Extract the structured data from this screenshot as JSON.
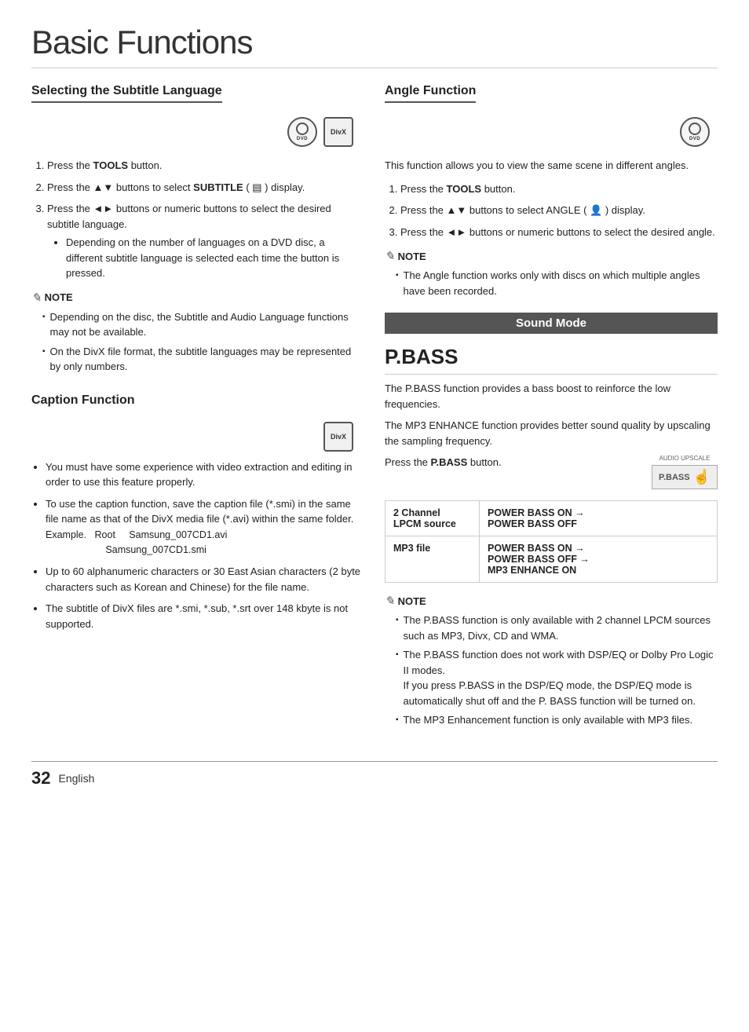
{
  "page": {
    "title": "Basic Functions",
    "footer_number": "32",
    "footer_lang": "English"
  },
  "left": {
    "section1_title": "Selecting the Subtitle Language",
    "step1": "Press the ",
    "step1_bold": "TOOLS",
    "step1_end": " button.",
    "step2": "Press the ▲▼ buttons to select ",
    "step2_bold": "SUBTITLE",
    "step2_end": " (     ) display.",
    "step3": "Press the ◄► buttons or numeric buttons to select the desired subtitle language.",
    "step3_bullet": "Depending on the number of languages on a DVD disc, a different subtitle language is selected each time the button is pressed.",
    "note_title": "NOTE",
    "note1": "Depending on the disc, the Subtitle and Audio Language functions may not be available.",
    "note2": "On the DivX file format, the subtitle languages may be represented by only numbers.",
    "caption_title": "Caption Function",
    "caption_bullets": [
      "You must have some experience with video extraction and editing in order to use this feature properly.",
      "To use the caption function, save the caption file (*.smi) in the same file name as that of the DivX media file (*.avi) within the same folder.\nExample.   Root     Samsung_007CD1.avi\n                         Samsung_007CD1.smi",
      "Up to 60 alphanumeric characters or 30 East Asian characters (2 byte characters such as Korean and Chinese) for the file name.",
      "The subtitle of DivX files are *.smi, *.sub, *.srt over 148 kbyte is not supported."
    ]
  },
  "right": {
    "angle_title": "Angle Function",
    "angle_intro": "This function allows you to view the same scene in different angles.",
    "angle_step1": "Press the ",
    "angle_step1_bold": "TOOLS",
    "angle_step1_end": " button.",
    "angle_step2": "Press the ▲▼ buttons to select ANGLE (     ) display.",
    "angle_step3": "Press the ◄► buttons or numeric buttons to select the desired angle.",
    "angle_note": "The Angle function works only with discs on which multiple angles have been recorded.",
    "sound_mode_header": "Sound Mode",
    "pbass_title": "P.BASS",
    "pbass_desc1": "The P.BASS function provides a bass boost to reinforce the low frequencies.",
    "pbass_desc2": "The MP3 ENHANCE function provides better sound quality by upscaling the sampling frequency.",
    "press_label": "Press the ",
    "press_bold": "P.BASS",
    "press_end": " button.",
    "audio_upscale": "AUDIO UPSCALE",
    "pbass_button": "P.BASS",
    "table_row1_left1": "2 Channel",
    "table_row1_left2": "LPCM source",
    "table_row1_right1": "POWER BASS ON →",
    "table_row1_right2": "POWER BASS OFF",
    "table_row2_left": "MP3 file",
    "table_row2_right1": "POWER BASS ON →",
    "table_row2_right2": "POWER BASS OFF →",
    "table_row2_right3": "MP3 ENHANCE ON",
    "note2_title": "NOTE",
    "note2_items": [
      "The P.BASS function is only available with 2 channel LPCM sources such as MP3, Divx, CD and WMA.",
      "The P.BASS function does not work with DSP/EQ or Dolby Pro Logic II modes.\nIf you press P.BASS in the DSP/EQ mode, the DSP/EQ mode is automatically shut off and the P. BASS function will be turned on.",
      "The MP3 Enhancement function is only available with MP3 files."
    ]
  }
}
